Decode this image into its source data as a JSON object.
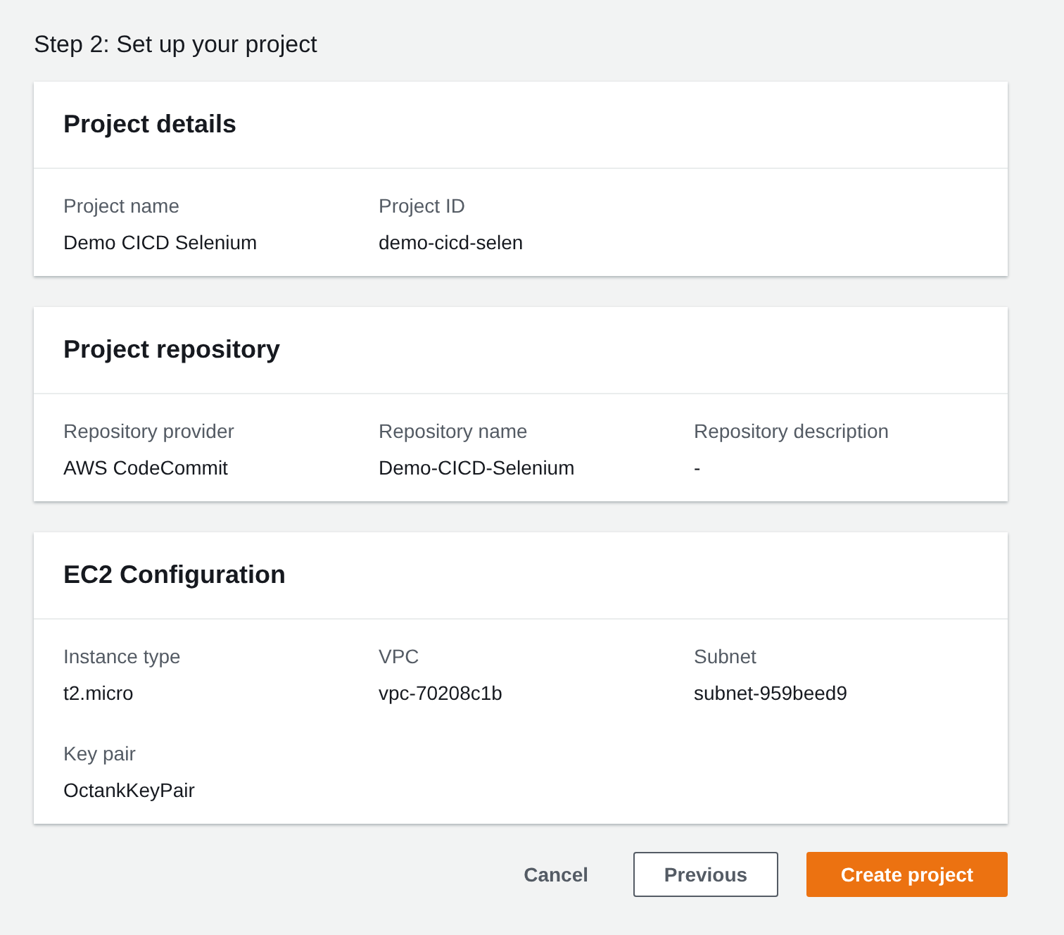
{
  "title": "Step 2: Set up your project",
  "sections": [
    {
      "title": "Project details",
      "fields": [
        {
          "label": "Project name",
          "value": "Demo CICD Selenium"
        },
        {
          "label": "Project ID",
          "value": "demo-cicd-selen"
        }
      ]
    },
    {
      "title": "Project repository",
      "fields": [
        {
          "label": "Repository provider",
          "value": "AWS CodeCommit"
        },
        {
          "label": "Repository name",
          "value": "Demo-CICD-Selenium"
        },
        {
          "label": "Repository description",
          "value": "-"
        }
      ]
    },
    {
      "title": "EC2 Configuration",
      "fields": [
        {
          "label": "Instance type",
          "value": "t2.micro"
        },
        {
          "label": "VPC",
          "value": "vpc-70208c1b"
        },
        {
          "label": "Subnet",
          "value": "subnet-959beed9"
        },
        {
          "label": "Key pair",
          "value": "OctankKeyPair"
        }
      ]
    }
  ],
  "buttons": [
    {
      "label": "Cancel",
      "kind": "link"
    },
    {
      "label": "Previous",
      "kind": "normal"
    },
    {
      "label": "Create project",
      "kind": "primary"
    }
  ]
}
